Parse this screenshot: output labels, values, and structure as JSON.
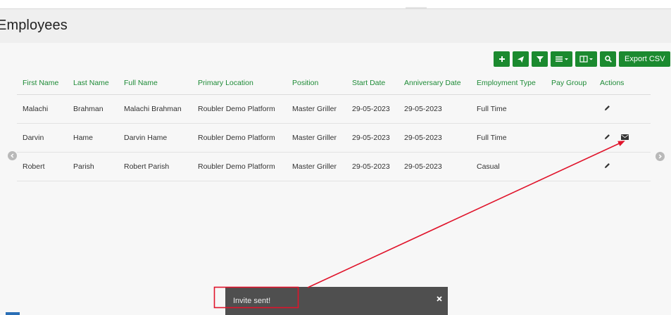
{
  "page": {
    "title": "Employees"
  },
  "toolbar": {
    "add_icon": "plus-icon",
    "send_icon": "paper-plane-icon",
    "filter_icon": "filter-icon",
    "list_icon": "list-dropdown-icon",
    "columns_icon": "columns-dropdown-icon",
    "search_icon": "search-icon",
    "export_label": "Export CSV",
    "color": "#1b8a2f"
  },
  "table": {
    "headers": [
      "First Name",
      "Last Name",
      "Full Name",
      "Primary Location",
      "Position",
      "Start Date",
      "Anniversary Date",
      "Employment Type",
      "Pay Group",
      "Actions"
    ],
    "rows": [
      [
        "Malachi",
        "Brahman",
        "Malachi Brahman",
        "Roubler Demo Platform",
        "Master Griller",
        "29-05-2023",
        "29-05-2023",
        "Full Time",
        ""
      ],
      [
        "Darvin",
        "Hame",
        "Darvin Hame",
        "Roubler Demo Platform",
        "Master Griller",
        "29-05-2023",
        "29-05-2023",
        "Full Time",
        ""
      ],
      [
        "Robert",
        "Parish",
        "Robert Parish",
        "Roubler Demo Platform",
        "Master Griller",
        "29-05-2023",
        "29-05-2023",
        "Casual",
        ""
      ]
    ],
    "row_actions": [
      [
        "pencil-icon"
      ],
      [
        "pencil-icon",
        "envelope-icon"
      ],
      [
        "pencil-icon"
      ]
    ],
    "header_color": "#1e8b37"
  },
  "navigation": {
    "left_icon": "chevron-left-icon",
    "right_icon": "chevron-right-icon"
  },
  "toast": {
    "message": "Invite sent!",
    "close_icon": "close-icon"
  },
  "annotation": {
    "color": "#e0142b"
  }
}
